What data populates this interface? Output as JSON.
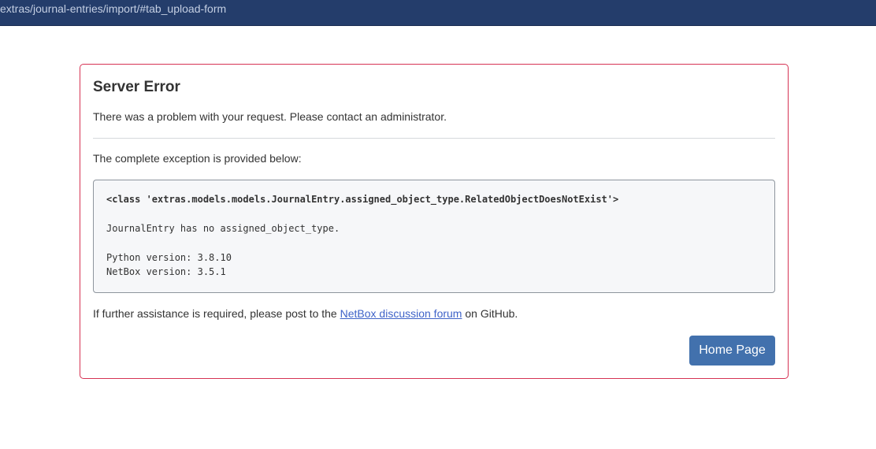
{
  "browser": {
    "url_fragment": "extras/journal-entries/import/#tab_upload-form"
  },
  "error_card": {
    "title": "Server Error",
    "problem_text": "There was a problem with your request. Please contact an administrator.",
    "exception_intro": "The complete exception is provided below:",
    "exception": {
      "class_line": "<class 'extras.models.models.JournalEntry.assigned_object_type.RelatedObjectDoesNotExist'>",
      "message": "JournalEntry has no assigned_object_type.",
      "python_version": "Python version: 3.8.10",
      "netbox_version": "NetBox version: 3.5.1"
    },
    "further_prefix": "If further assistance is required, please post to the ",
    "forum_link": "NetBox discussion forum",
    "further_suffix": " on GitHub.",
    "home_button": "Home Page"
  },
  "colors": {
    "topbar": "#243d6b",
    "card_border": "#d63354",
    "button": "#4271ad",
    "link": "#3f63c8"
  }
}
